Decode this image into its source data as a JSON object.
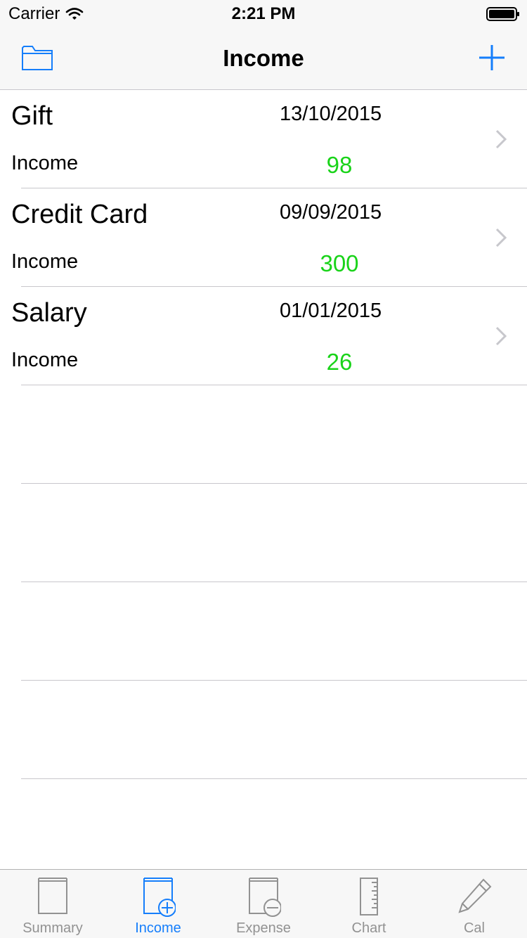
{
  "status": {
    "carrier": "Carrier",
    "time": "2:21 PM"
  },
  "nav": {
    "title": "Income",
    "left_icon": "folder-icon",
    "right_icon": "plus-icon"
  },
  "colors": {
    "accent": "#157efb",
    "amount": "#19d319",
    "inactive": "#929292"
  },
  "items": [
    {
      "name": "Gift",
      "date": "13/10/2015",
      "type": "Income",
      "amount": "98"
    },
    {
      "name": "Credit Card",
      "date": "09/09/2015",
      "type": "Income",
      "amount": "300"
    },
    {
      "name": "Salary",
      "date": "01/01/2015",
      "type": "Income",
      "amount": "26"
    }
  ],
  "tabs": [
    {
      "label": "Summary",
      "icon": "book-icon",
      "active": false
    },
    {
      "label": "Income",
      "icon": "book-plus-icon",
      "active": true
    },
    {
      "label": "Expense",
      "icon": "book-minus-icon",
      "active": false
    },
    {
      "label": "Chart",
      "icon": "ruler-icon",
      "active": false
    },
    {
      "label": "Cal",
      "icon": "pencil-icon",
      "active": false
    }
  ]
}
